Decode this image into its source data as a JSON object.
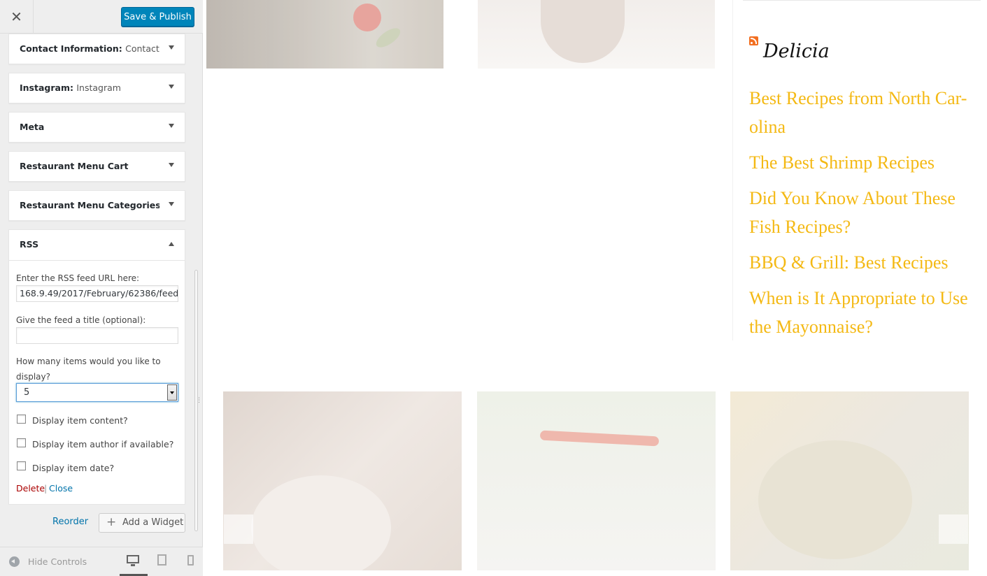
{
  "header": {
    "close_icon": "✕",
    "save_label": "Save & Publish"
  },
  "widgets": [
    {
      "title": "Contact Information:",
      "subtitle": "Contact..."
    },
    {
      "title": "Instagram:",
      "subtitle": "Instagram"
    },
    {
      "title": "Meta",
      "subtitle": ""
    },
    {
      "title": "Restaurant Menu Cart",
      "subtitle": ""
    },
    {
      "title": "Restaurant Menu Categories",
      "subtitle": ""
    }
  ],
  "rss_widget": {
    "title": "RSS",
    "url_label": "Enter the RSS feed URL here:",
    "url_value": "168.9.49/2017/February/62386/feed",
    "feed_title_label": "Give the feed a title (optional):",
    "feed_title_value": "",
    "items_label_line1": "How many items would you like to",
    "items_label_line2": "display?",
    "items_value": "5",
    "checkbox_content": "Display item content?",
    "checkbox_author": "Display item author if available?",
    "checkbox_date": "Display item date?",
    "delete_label": "Delete",
    "separator": "|",
    "close_label": "Close"
  },
  "actions": {
    "reorder_label": "Reorder",
    "add_widget_label": "Add a Widget",
    "add_plus": "+"
  },
  "footer": {
    "hide_controls_label": "Hide Controls",
    "resize_grip": "⋮"
  },
  "preview": {
    "rss_widget_title": "Delicia",
    "posts": [
      "Best Recipes from North Car-olina",
      "The Best Shrimp Recipes",
      "Did You Know About These Fish Recipes?",
      "BBQ & Grill: Best Recipes",
      "When is It Appropriate to Use the Mayonnaise?"
    ],
    "link_color": "#f4b914"
  },
  "colors": {
    "primary_button": "#0085ba",
    "link": "#0073aa",
    "delete": "#aa0000"
  },
  "icons": {
    "close": "close-icon",
    "arrow_down": "arrow-down-icon",
    "arrow_up": "arrow-up-icon",
    "rss": "rss-icon",
    "plus": "plus-icon",
    "hide": "hide-controls-icon",
    "desktop": "desktop-icon",
    "tablet": "tablet-icon",
    "mobile": "mobile-icon"
  }
}
